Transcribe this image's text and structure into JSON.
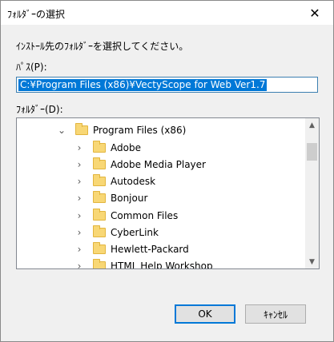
{
  "window": {
    "title": "ﾌｫﾙﾀﾞｰの選択",
    "close_glyph": "✕"
  },
  "prompt": "ｲﾝｽﾄｰﾙ先のﾌｫﾙﾀﾞｰを選択してください。",
  "path": {
    "label": "ﾊﾟｽ(P):",
    "value": "C:¥Program Files (x86)¥VectyScope for Web Ver1.7"
  },
  "folder_tree": {
    "label": "ﾌｫﾙﾀﾞｰ(D):",
    "items": [
      {
        "label": "Program Files (x86)",
        "expanded": true
      },
      {
        "label": "Adobe"
      },
      {
        "label": "Adobe Media Player"
      },
      {
        "label": "Autodesk"
      },
      {
        "label": "Bonjour"
      },
      {
        "label": "Common Files"
      },
      {
        "label": "CyberLink"
      },
      {
        "label": "Hewlett-Packard"
      },
      {
        "label": "HTML Help Workshop"
      }
    ]
  },
  "buttons": {
    "ok": "OK",
    "cancel": "ｷｬﾝｾﾙ"
  }
}
